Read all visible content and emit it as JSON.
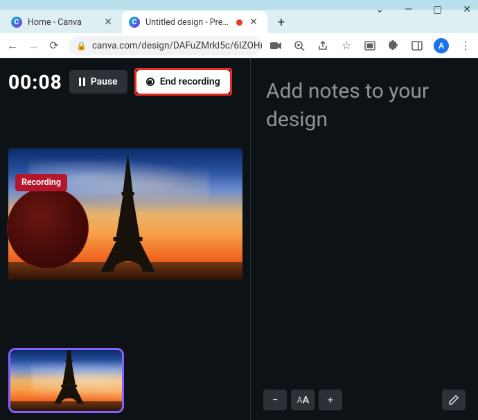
{
  "window": {
    "controls": {
      "min": "—",
      "max": "▢",
      "close": "✕",
      "chev": "⌄"
    }
  },
  "tabs": {
    "items": [
      {
        "title": "Home - Canva",
        "active": false
      },
      {
        "title": "Untitled design - Prese…",
        "active": true,
        "recording": true
      }
    ],
    "newtab": "+"
  },
  "toolbar": {
    "url": "canva.com/design/DAFuZMrkI5c/6IZOHI…",
    "avatar_letter": "A"
  },
  "recorder": {
    "timer": "00:08",
    "pause_label": "Pause",
    "end_label": "End recording",
    "badge": "Recording"
  },
  "notes": {
    "placeholder": "Add notes to your design"
  },
  "bottom": {
    "minus": "−",
    "smallA": "A",
    "bigA": "A",
    "plus": "+"
  }
}
